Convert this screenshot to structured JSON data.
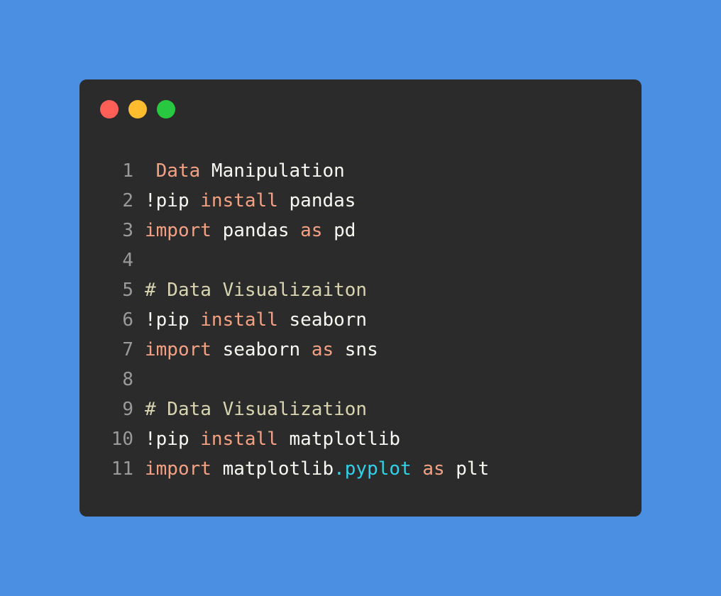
{
  "window": {
    "controls": [
      "close",
      "minimize",
      "maximize"
    ],
    "colors": {
      "background": "#4a8fe2",
      "editor": "#2b2b2b",
      "keyword": "#f4a183",
      "comment": "#d8d4b0",
      "text": "#f8f8f2",
      "attribute": "#2ed3e8",
      "line_number": "#9a9a9a"
    }
  },
  "code": {
    "lines": [
      {
        "n": "1",
        "tokens": [
          {
            "t": " "
          },
          {
            "t": "Data",
            "c": "kw"
          },
          {
            "t": " Manipulation"
          }
        ]
      },
      {
        "n": "2",
        "tokens": [
          {
            "t": "!pip "
          },
          {
            "t": "install",
            "c": "kw"
          },
          {
            "t": " pandas"
          }
        ]
      },
      {
        "n": "3",
        "tokens": [
          {
            "t": "import",
            "c": "kw"
          },
          {
            "t": " pandas "
          },
          {
            "t": "as",
            "c": "kw"
          },
          {
            "t": " pd"
          }
        ]
      },
      {
        "n": "4",
        "tokens": []
      },
      {
        "n": "5",
        "tokens": [
          {
            "t": "# Data Visualizaiton",
            "c": "cm"
          }
        ]
      },
      {
        "n": "6",
        "tokens": [
          {
            "t": "!pip "
          },
          {
            "t": "install",
            "c": "kw"
          },
          {
            "t": " seaborn"
          }
        ]
      },
      {
        "n": "7",
        "tokens": [
          {
            "t": "import",
            "c": "kw"
          },
          {
            "t": " seaborn "
          },
          {
            "t": "as",
            "c": "kw"
          },
          {
            "t": " sns"
          }
        ]
      },
      {
        "n": "8",
        "tokens": []
      },
      {
        "n": "9",
        "tokens": [
          {
            "t": "# Data Visualization",
            "c": "cm"
          }
        ]
      },
      {
        "n": "10",
        "tokens": [
          {
            "t": "!pip "
          },
          {
            "t": "install",
            "c": "kw"
          },
          {
            "t": " matplotlib"
          }
        ]
      },
      {
        "n": "11",
        "tokens": [
          {
            "t": "import",
            "c": "kw"
          },
          {
            "t": " matplotlib"
          },
          {
            "t": ".pyplot",
            "c": "at"
          },
          {
            "t": " "
          },
          {
            "t": "as",
            "c": "kw"
          },
          {
            "t": " plt"
          }
        ]
      }
    ]
  }
}
